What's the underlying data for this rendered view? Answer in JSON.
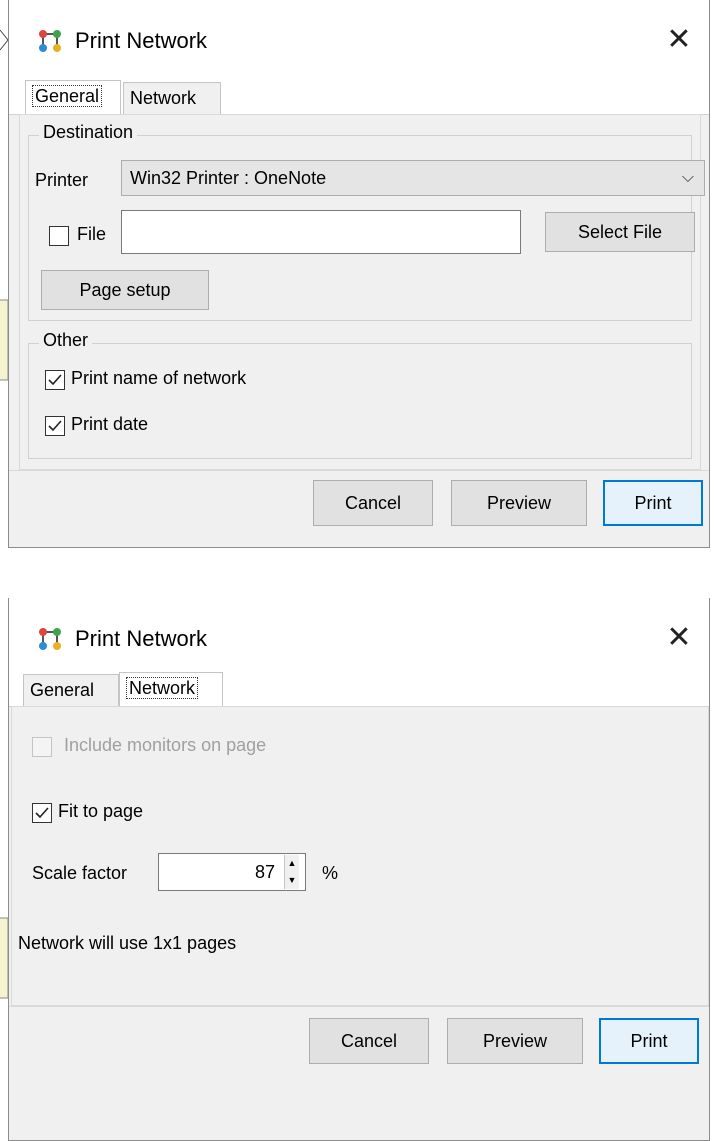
{
  "dialogs": [
    {
      "title": "Print Network",
      "tabs": [
        "General",
        "Network"
      ],
      "active_tab": "General",
      "destination": {
        "legend": "Destination",
        "printer_label": "Printer",
        "printer_value": "Win32 Printer : OneNote",
        "file_label": "File",
        "file_checked": false,
        "file_value": "",
        "select_file_label": "Select File",
        "page_setup_label": "Page setup"
      },
      "other": {
        "legend": "Other",
        "print_name_label": "Print name of network",
        "print_name_checked": true,
        "print_date_label": "Print date",
        "print_date_checked": true
      },
      "buttons": {
        "cancel": "Cancel",
        "preview": "Preview",
        "print": "Print"
      }
    },
    {
      "title": "Print Network",
      "tabs": [
        "General",
        "Network"
      ],
      "active_tab": "Network",
      "network": {
        "include_monitors_label": "Include monitors on page",
        "include_monitors_checked": false,
        "include_monitors_enabled": false,
        "fit_to_page_label": "Fit to page",
        "fit_to_page_checked": true,
        "scale_factor_label": "Scale factor",
        "scale_factor_value": "87",
        "scale_unit": "%",
        "pages_info": "Network will use 1x1 pages"
      },
      "buttons": {
        "cancel": "Cancel",
        "preview": "Preview",
        "print": "Print"
      }
    }
  ],
  "colors": {
    "accent": "#0078d7",
    "dialog_bg": "#f0f0f0",
    "title_bg": "#ffffff"
  }
}
